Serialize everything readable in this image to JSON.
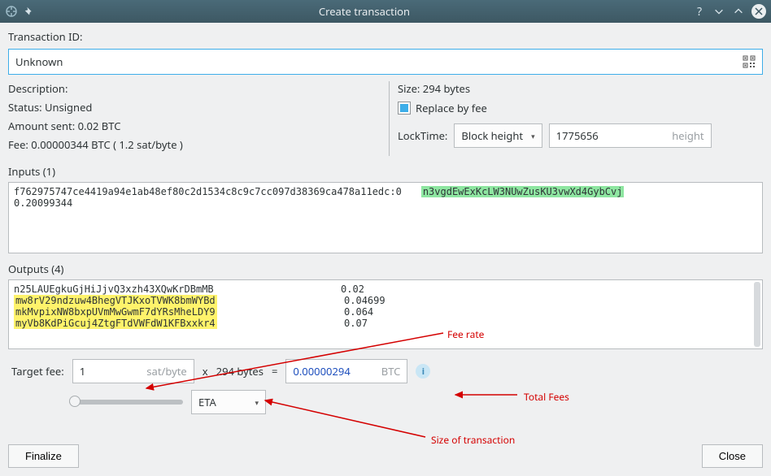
{
  "window": {
    "title": "Create transaction"
  },
  "txid": {
    "label": "Transaction ID:",
    "value": "Unknown"
  },
  "left": {
    "description_label": "Description:",
    "status_label": "Status: Unsigned",
    "amount_label": "Amount sent: 0.02 BTC",
    "fee_label": "Fee: 0.00000344 BTC  ( 1.2 sat/byte )"
  },
  "right": {
    "size_label": "Size: 294 bytes",
    "rbf_label": "Replace by fee",
    "locktime_label": "LockTime:",
    "locktime_type": "Block height",
    "locktime_value": "1775656",
    "locktime_placeholder": "height"
  },
  "inputs": {
    "title": "Inputs (1)",
    "txref": "f762975747ce4419a94e1ab48ef80c2d1534c8c9c7cc097d38369ca478a11edc:0",
    "addr": "n3vgdEwExKcLW3NUwZusKU3vwXd4GybCvj",
    "amount": "0.20099344"
  },
  "outputs": {
    "title": "Outputs (4)",
    "rows": [
      {
        "addr": "n25LAUEgkuGjHiJjvQ3xzh43XQwKrDBmMB",
        "amount": "0.02",
        "hl": false
      },
      {
        "addr": "mw8rV29ndzuw4BhegVTJKxoTVWK8bmWYBd",
        "amount": "0.04699",
        "hl": true
      },
      {
        "addr": "mkMvpixNW8bxpUVmMwGwmF7dYRsMheLDY9",
        "amount": "0.064",
        "hl": true
      },
      {
        "addr": "myVb8KdPiGcuj4ZtgFTdVWFdW1KFBxxkr4",
        "amount": "0.07",
        "hl": true
      }
    ]
  },
  "target": {
    "label": "Target fee:",
    "rate_value": "1",
    "rate_unit": "sat/byte",
    "mult": "x",
    "size": "294 bytes",
    "eq": "=",
    "btc_value": "0.00000294",
    "btc_unit": "BTC",
    "est_selected": "ETA"
  },
  "buttons": {
    "finalize": "Finalize",
    "close": "Close"
  },
  "annotations": {
    "fee_rate": "Fee rate",
    "total_fees": "Total Fees",
    "size_tx": "Size of transaction"
  }
}
